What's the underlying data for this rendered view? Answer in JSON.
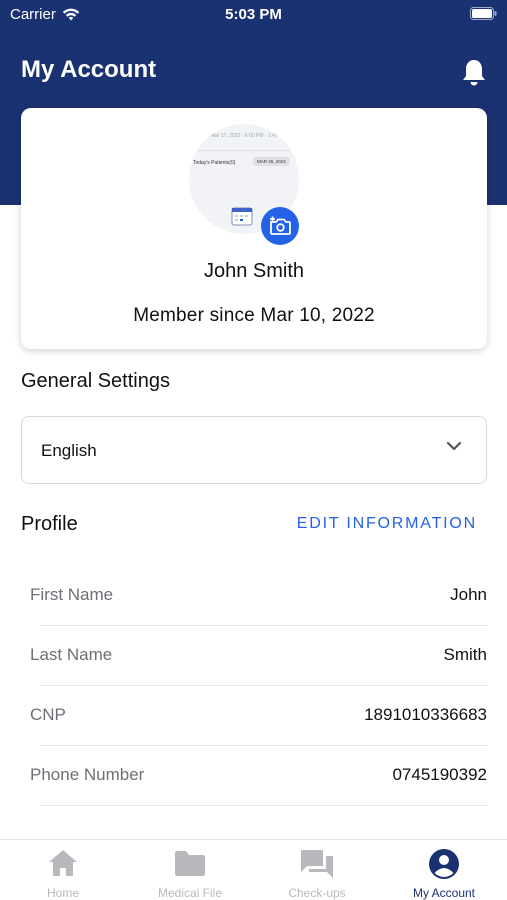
{
  "status_bar": {
    "carrier": "Carrier",
    "time": "5:03 PM"
  },
  "header": {
    "title": "My Account"
  },
  "profile_card": {
    "avatar_preview": {
      "top_line": "Mar 17, 2022 · 6:00 PM · 1:47",
      "patients_label": "Today's Patients(0)",
      "date_chip": "MAR 26, 2022"
    },
    "name": "John Smith",
    "member_since": "Member since Mar 10, 2022"
  },
  "general_settings": {
    "title": "General Settings",
    "language": {
      "selected": "English"
    }
  },
  "profile": {
    "title": "Profile",
    "edit_label": "EDIT INFORMATION",
    "fields": [
      {
        "label": "First Name",
        "value": "John"
      },
      {
        "label": "Last Name",
        "value": "Smith"
      },
      {
        "label": "CNP",
        "value": "1891010336683"
      },
      {
        "label": "Phone Number",
        "value": "0745190392"
      }
    ]
  },
  "tabbar": {
    "items": [
      {
        "label": "Home",
        "icon": "home-icon"
      },
      {
        "label": "Medical File",
        "icon": "folder-icon"
      },
      {
        "label": "Check-ups",
        "icon": "chat-icon"
      },
      {
        "label": "My Account",
        "icon": "account-icon",
        "active": true
      }
    ]
  },
  "colors": {
    "header_bg": "#1b3272",
    "accent": "#2462e6",
    "inactive_tab": "#b7b9bd"
  }
}
